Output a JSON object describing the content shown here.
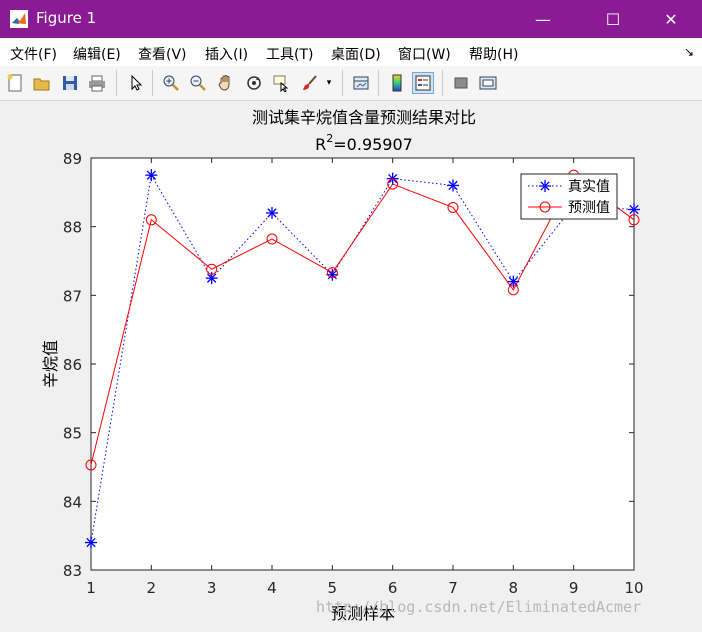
{
  "window": {
    "title": "Figure 1",
    "controls": {
      "minimize": "—",
      "maximize": "☐",
      "close": "✕"
    }
  },
  "menu": {
    "items": [
      "文件(F)",
      "编辑(E)",
      "查看(V)",
      "插入(I)",
      "工具(T)",
      "桌面(D)",
      "窗口(W)",
      "帮助(H)"
    ],
    "overflow": "↘"
  },
  "toolbar": {
    "icons": [
      "new-figure-icon",
      "open-file-icon",
      "save-icon",
      "print-icon",
      "select-arrow-icon",
      "zoom-in-icon",
      "zoom-out-icon",
      "pan-hand-icon",
      "rotate-3d-icon",
      "data-cursor-icon",
      "brush-icon",
      "brush-dropdown-icon",
      "link-plot-icon",
      "colorbar-icon",
      "legend-icon",
      "hide-tools-icon",
      "show-tools-icon"
    ]
  },
  "watermark": "http://blog.csdn.net/EliminatedAcmer",
  "chart_data": {
    "type": "line",
    "title": "测试集辛烷值含量预测结果对比",
    "subtitle_prefix": "R",
    "subtitle_sup": "2",
    "subtitle_value": "=0.95907",
    "xlabel": "预测样本",
    "ylabel": "辛烷值",
    "x": [
      1,
      2,
      3,
      4,
      5,
      6,
      7,
      8,
      9,
      10
    ],
    "xlim": [
      1,
      10
    ],
    "ylim": [
      83,
      89
    ],
    "xticks": [
      "1",
      "2",
      "3",
      "4",
      "5",
      "6",
      "7",
      "8",
      "9",
      "10"
    ],
    "yticks": [
      "83",
      "84",
      "85",
      "86",
      "87",
      "88",
      "89"
    ],
    "grid": false,
    "legend_position": "top-right",
    "series": [
      {
        "name": "真实值",
        "values": [
          83.4,
          88.75,
          87.25,
          88.2,
          87.3,
          88.7,
          88.6,
          87.2,
          88.3,
          88.25
        ],
        "color": "#0000ff",
        "line": "dotted",
        "marker": "asterisk"
      },
      {
        "name": "预测值",
        "values": [
          84.53,
          88.1,
          87.38,
          87.82,
          87.33,
          88.62,
          88.28,
          87.08,
          88.75,
          88.1
        ],
        "color": "#ff0000",
        "line": "solid",
        "marker": "circle"
      }
    ]
  }
}
